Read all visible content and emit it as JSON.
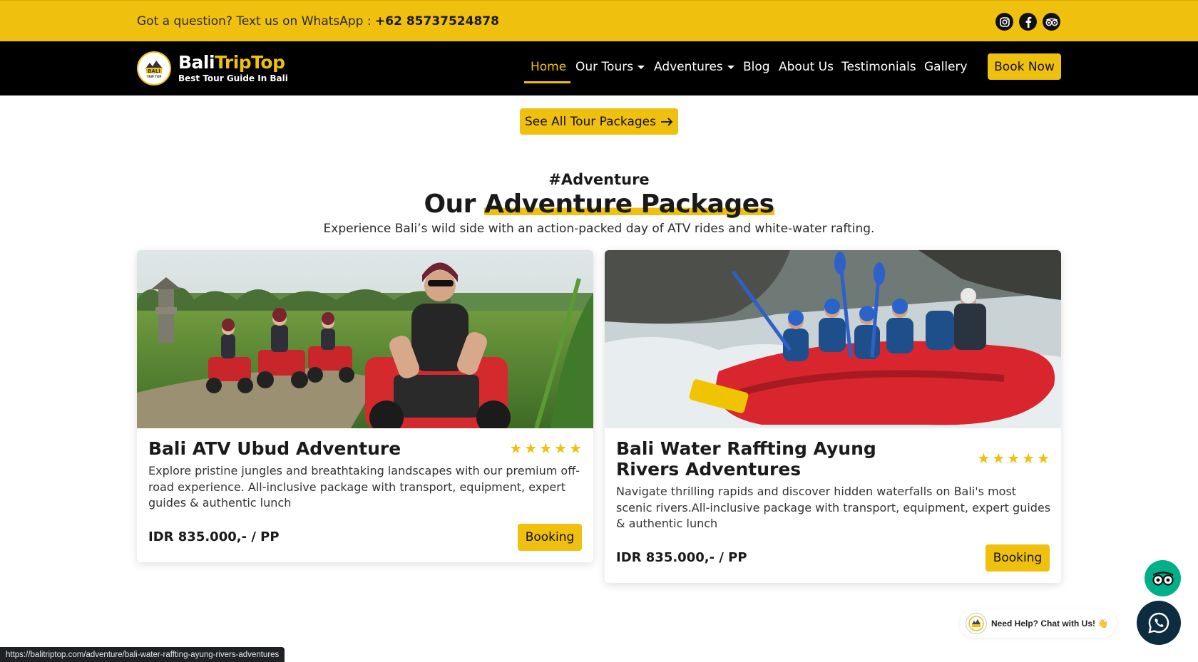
{
  "topbar": {
    "question": "Got a question? Text us on WhatsApp : ",
    "phone": "+62 85737524878",
    "socials": [
      "instagram-icon",
      "facebook-icon",
      "tripadvisor-icon"
    ]
  },
  "brand": {
    "logo_text": "BALI",
    "logo_sub": "TRIP TOP",
    "name_part1": "Bali",
    "name_part2": "TripTop",
    "tagline": "Best Tour Guide In Bali"
  },
  "nav": {
    "items": [
      {
        "label": "Home",
        "active": true
      },
      {
        "label": "Our Tours",
        "dropdown": true
      },
      {
        "label": "Adventures",
        "dropdown": true
      },
      {
        "label": "Blog"
      },
      {
        "label": "About Us"
      },
      {
        "label": "Testimonials"
      },
      {
        "label": "Gallery"
      }
    ],
    "cta": "Book Now"
  },
  "see_all": {
    "label": "See All Tour Packages"
  },
  "section": {
    "eyebrow": "#Adventure",
    "title_plain": "Our ",
    "title_highlight": "Adventure Packages",
    "subtitle": "Experience Bali’s wild side with an action-packed day of ATV rides and white-water rafting."
  },
  "cards": [
    {
      "title": "Bali ATV Ubud Adventure",
      "rating": 5,
      "description": "Explore pristine jungles and breathtaking landscapes with our premium off-road experience. All-inclusive package with transport, equipment, expert guides & authentic lunch",
      "price": "IDR 835.000,- / PP",
      "button": "Booking"
    },
    {
      "title": "Bali Water Raffting Ayung Rivers Adventures",
      "rating": 5,
      "description": "Navigate thrilling rapids and discover hidden waterfalls on Bali's most scenic rivers.All-inclusive package with transport, equipment, expert guides & authentic lunch",
      "price": "IDR 835.000,- / PP",
      "button": "Booking"
    }
  ],
  "chat": {
    "help_text": "Need Help? Chat with Us! 👋"
  },
  "status_bar": {
    "url": "https://balitriptop.com/adventure/bali-water-raffting-ayung-rivers-adventures"
  },
  "colors": {
    "accent": "#f0c00e",
    "nav_bg": "#000000",
    "tripadvisor": "#00af87",
    "whatsapp_bg": "#0d2c3f"
  }
}
